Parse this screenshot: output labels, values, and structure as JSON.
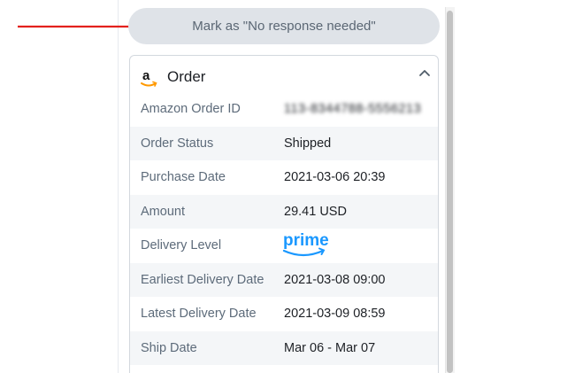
{
  "mark_button": {
    "label": "Mark as \"No response needed\""
  },
  "order_card": {
    "title": "Order",
    "logo_letter": "a",
    "rows": [
      {
        "key": "Amazon Order ID",
        "value": "113-8344788-5556213",
        "value_blurred": true
      },
      {
        "key": "Order Status",
        "value": "Shipped"
      },
      {
        "key": "Purchase Date",
        "value": "2021-03-06 20:39"
      },
      {
        "key": "Amount",
        "value": "29.41 USD"
      },
      {
        "key": "Delivery Level",
        "value": "prime",
        "value_is_logo": true
      },
      {
        "key": "Earliest Delivery Date",
        "value": "2021-03-08 09:00"
      },
      {
        "key": "Latest Delivery Date",
        "value": "2021-03-09 08:59"
      },
      {
        "key": "Ship Date",
        "value": "Mar 06 - Mar 07"
      }
    ]
  },
  "icons": {
    "annotation": "red-arrow-icon",
    "logo": "amazon-logo-icon",
    "collapse": "chevron-up-icon",
    "prime": "prime-logo-icon"
  },
  "colors": {
    "arrow": "#e3211d",
    "prime_blue": "#1a98ff",
    "link_blue": "#6fb1ee",
    "button_bg": "#dfe3e8"
  }
}
